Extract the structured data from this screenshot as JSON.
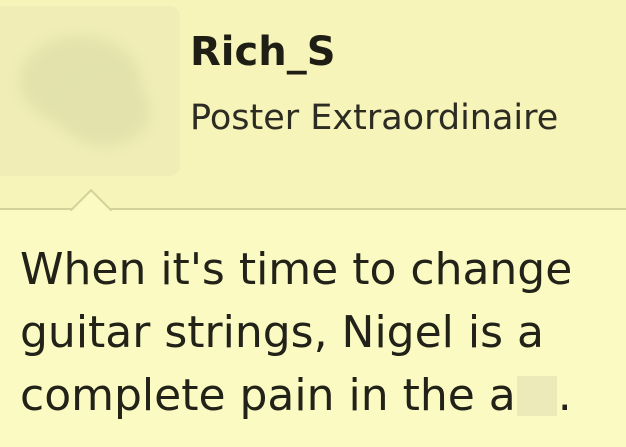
{
  "post": {
    "author": {
      "username": "Rich_S",
      "title": "Poster Extraordinaire"
    },
    "body": {
      "line1": "When it's time to change",
      "line2": "guitar strings, Nigel is a",
      "line3_before": "complete pain in the a",
      "line3_after": "."
    }
  }
}
